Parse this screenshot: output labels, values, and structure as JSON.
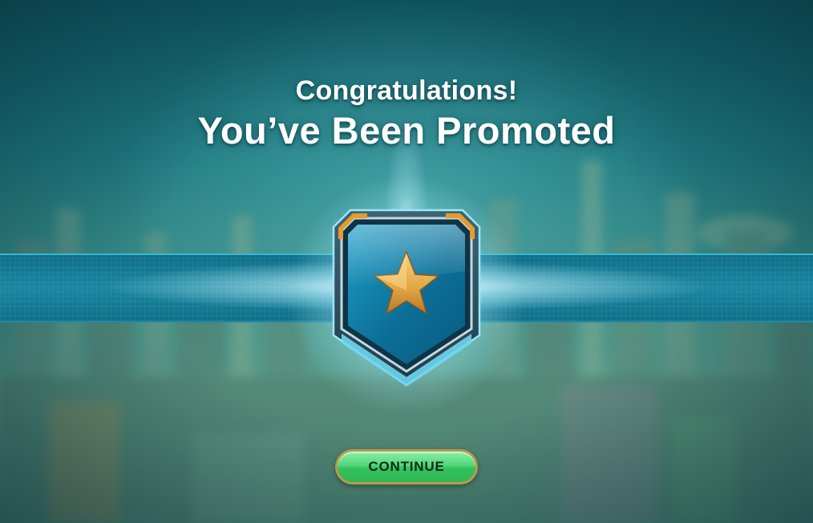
{
  "screen": "promotion",
  "header": {
    "line1": "Congratulations!",
    "line2": "You’ve Been Promoted"
  },
  "badge": {
    "shape": "shield",
    "emblem": "star-icon",
    "colors": {
      "frame": "#2c4f5f",
      "inner": "#0e7aa6",
      "corner_accents": "#e79b2b",
      "star": "#e0a84a"
    }
  },
  "continue_button": {
    "label": "CONTINUE",
    "color": "#4fd276",
    "border_color": "#b89a4a"
  },
  "colors": {
    "background": "#2a7a80",
    "band": "#1a86a0",
    "glow": "#ffffff"
  }
}
